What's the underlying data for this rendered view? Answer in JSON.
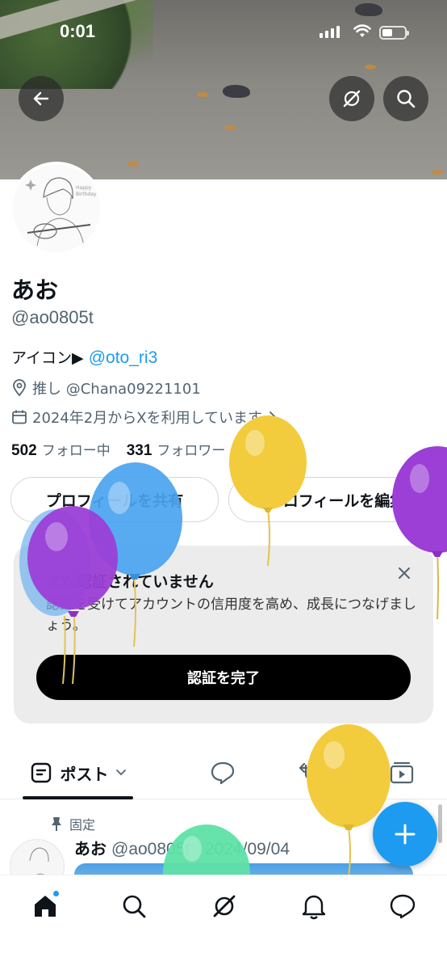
{
  "status_bar": {
    "time": "0:01"
  },
  "header": {
    "back_icon": "arrow-left-icon",
    "grok_icon": "grok-slash-icon",
    "search_icon": "search-icon"
  },
  "profile": {
    "display_name": "あお",
    "handle": "@ao0805t",
    "bio_prefix": "アイコン▶",
    "bio_mention": "@oto_ri3",
    "location": "推し @Chana09221101",
    "joined": "2024年2月からXを利用しています",
    "following_count": "502",
    "following_label": "フォロー中",
    "followers_count": "331",
    "followers_label": "フォロワー",
    "share_button": "プロフィールを共有",
    "edit_button": "プロフィールを編集"
  },
  "verify_card": {
    "title": "まだ認証されていません",
    "text": "認証を受けてアカウントの信用度を高め、成長につなげましょう。",
    "button": "認証を完了"
  },
  "tabs": {
    "posts": "ポスト"
  },
  "pinned_post": {
    "pinned_label": "固定",
    "author": "あお",
    "handle_date": "@ao0805t · 2024/09/04"
  },
  "colors": {
    "accent": "#1d9bf0",
    "balloon_yellow": "#f2cc3d",
    "balloon_blue": "#4aa3f0",
    "balloon_purple": "#9b3fd6",
    "balloon_green": "#5ee0a6"
  }
}
